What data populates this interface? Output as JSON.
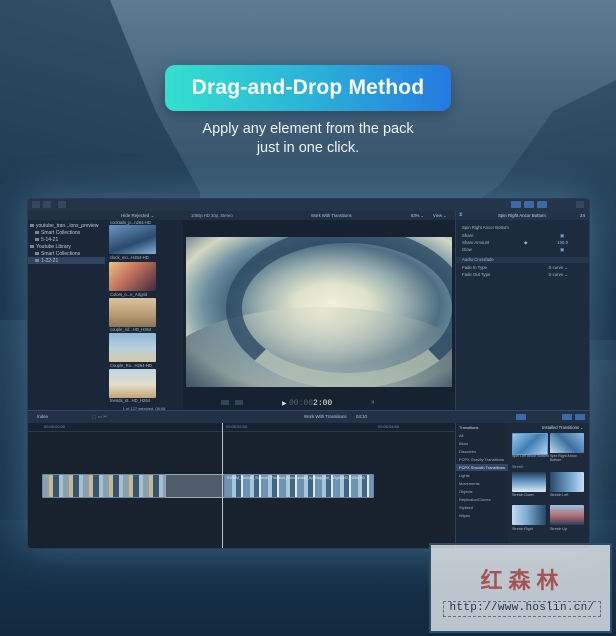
{
  "banner": {
    "title": "Drag-and-Drop Method",
    "subtitle_line1": "Apply any element from the pack",
    "subtitle_line2": "just in one click."
  },
  "app": {
    "library": {
      "items": [
        {
          "label": "youtube_tran...ions_preview",
          "indent": 0,
          "selected": false
        },
        {
          "label": "Smart Collections",
          "indent": 1,
          "selected": false
        },
        {
          "label": "5-14-21",
          "indent": 1,
          "selected": false
        },
        {
          "label": "Youtube Library",
          "indent": 0,
          "selected": false
        },
        {
          "label": "Smart Collections",
          "indent": 1,
          "selected": false
        },
        {
          "label": "1-22-21",
          "indent": 1,
          "selected": true
        }
      ]
    },
    "browser": {
      "filter": "Hide Rejected ⌄",
      "clips": [
        {
          "label": "clock_mo...H264-HD"
        },
        {
          "label": "Colors_o...e_Artgrid"
        },
        {
          "label": "couple_rid...HD_H264"
        },
        {
          "label": "Couple_Ro...H264-HD"
        },
        {
          "label": "friends_st...HD_H264"
        }
      ],
      "top_label": "cocktails_p...n264-HD",
      "count": "1 of 127 selected, 08:08"
    },
    "viewer": {
      "format": "1080p HD 30p, Stereo",
      "project": "Work With Transitions",
      "zoom": "83% ⌄",
      "view": "View ⌄",
      "timecode_dim": "00:00",
      "timecode": "2:00"
    },
    "inspector": {
      "title": "Spin Right Ancor Bottom",
      "duration": "24",
      "section": "Spin Right Ancor Bottom",
      "rows": [
        {
          "label": "Share",
          "value": ""
        },
        {
          "label": "Share Amount",
          "value": "100.0"
        },
        {
          "label": "Glow",
          "value": ""
        }
      ],
      "crossfade": "Audio Crossfade",
      "fade_in_label": "Fade In Type",
      "fade_in_value": "S-curve ⌄",
      "fade_out_label": "Fade Out Type",
      "fade_out_value": "S-curve ⌄"
    },
    "timeline": {
      "index_label": "Index",
      "project": "Work With Transitions",
      "duration": "04:10",
      "ruler": [
        "00:00:00:00",
        "00:00:02:00",
        "00:00:04:00"
      ],
      "clip_label": "RWMM_Woman_Summer_Freedom_Mountaintop_by_Majo_Art_Artgrid-HD_H264-HD"
    },
    "transitions": {
      "header": "Transitions",
      "installed": "Installed Transitions ⌄",
      "categories": [
        "All",
        "Blurs",
        "Dissolves",
        "FCPX Gravity Transitions",
        "FCPX Smooth Transitions",
        "Lights",
        "Movements",
        "Objects",
        "Replicator/Clones",
        "Stylized",
        "Wipes"
      ],
      "selected_category": "FCPX Smooth Transitions",
      "group": "Stretch",
      "items": [
        {
          "label": "Spin Left Ancor Bottom"
        },
        {
          "label": "Spin Right Ancor Bottom"
        },
        {
          "label": "Stretch Down"
        },
        {
          "label": "Stretch Left"
        },
        {
          "label": "Stretch Right"
        },
        {
          "label": "Stretch Up"
        }
      ]
    }
  },
  "watermark": {
    "chinese": "红森林",
    "url": "http://www.hoslin.cn/"
  }
}
